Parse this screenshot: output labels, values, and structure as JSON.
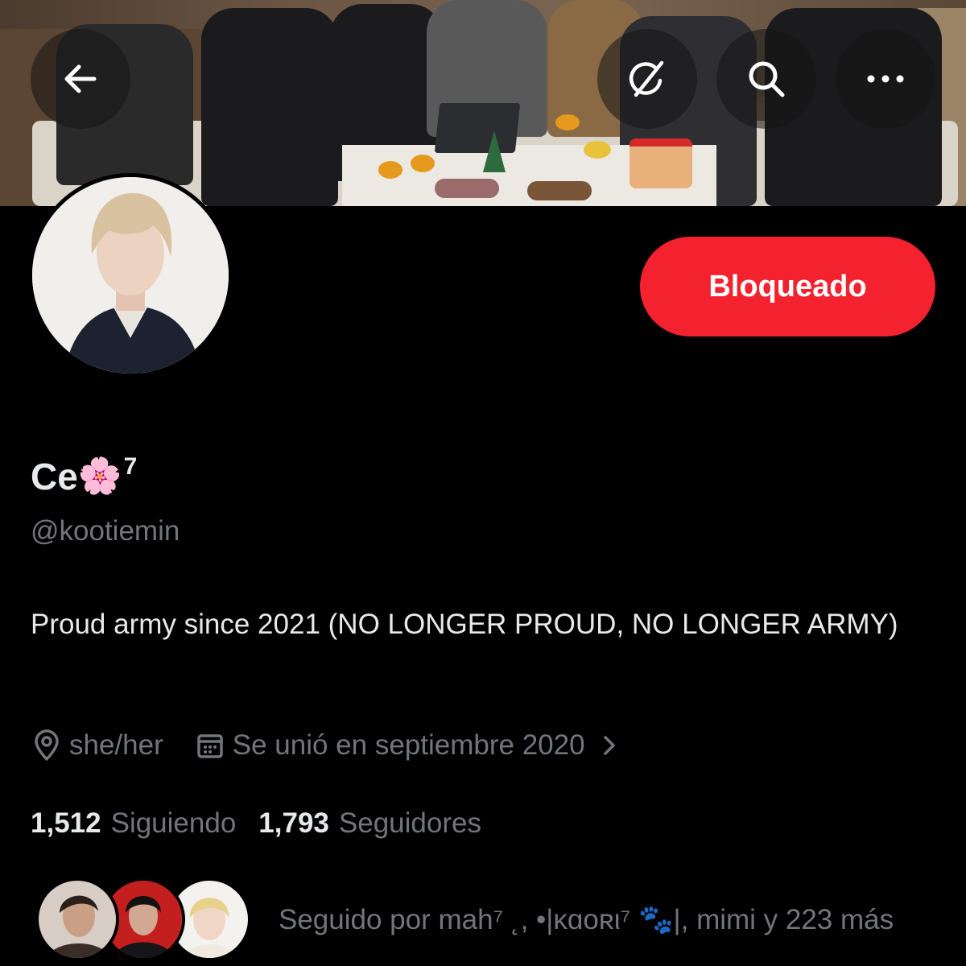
{
  "header": {
    "back_icon": "arrow-left-icon",
    "grok_icon": "grok-icon",
    "search_icon": "search-icon",
    "more_icon": "more-horizontal-icon"
  },
  "profile": {
    "display_name": "Ce",
    "name_emoji": "🌸",
    "name_suffix": "7",
    "handle": "@kootiemin",
    "bio": "Proud army since 2021 (NO LONGER PROUD, NO LONGER ARMY)",
    "location": "she/her",
    "joined": "Se unió en septiembre 2020",
    "following_count": "1,512",
    "following_label": "Siguiendo",
    "followers_count": "1,793",
    "followers_label": "Seguidores",
    "followed_by": "Seguido por mah⁷ ˛, •|ĸɑᴏʀι⁷ 🐾|, mimi y 223 más"
  },
  "actions": {
    "blocked_label": "Bloqueado"
  },
  "colors": {
    "background": "#000000",
    "blocked_button": "#f4212e",
    "secondary_text": "#71767b",
    "primary_text": "#e7e9ea"
  }
}
